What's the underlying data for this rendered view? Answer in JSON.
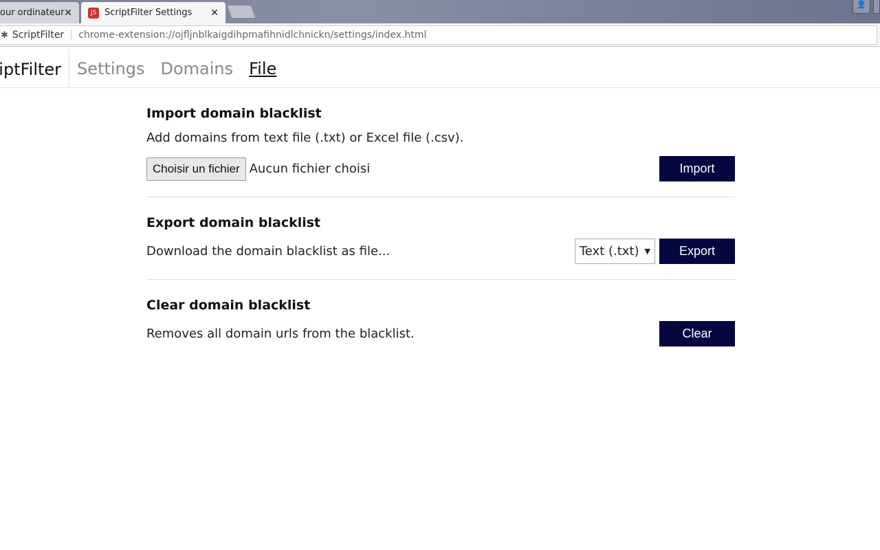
{
  "browser": {
    "tabs": [
      {
        "label": "our ordinateur",
        "active": false
      },
      {
        "label": "ScriptFilter Settings",
        "active": true
      }
    ],
    "close_glyph": "✕",
    "extension_name": "ScriptFilter",
    "url": "chrome-extension://ojfljnblkaigdihpmafihnidlchnickn/settings/index.html"
  },
  "nav": {
    "brand": "ScriptFilter",
    "links": [
      {
        "label": "Settings"
      },
      {
        "label": "Domains"
      },
      {
        "label": "File",
        "active": true
      }
    ]
  },
  "import": {
    "title": "Import domain blacklist",
    "description": "Add domains from text file (.txt) or Excel file (.csv).",
    "file_button": "Choisir un fichier",
    "file_status": "Aucun fichier choisi",
    "button": "Import"
  },
  "export": {
    "title": "Export domain blacklist",
    "description": "Download the domain blacklist as file...",
    "format_selected": "Text (.txt)",
    "button": "Export"
  },
  "clear": {
    "title": "Clear domain blacklist",
    "description": "Removes all domain urls from the blacklist.",
    "button": "Clear"
  },
  "colors": {
    "button_bg": "#050540"
  }
}
